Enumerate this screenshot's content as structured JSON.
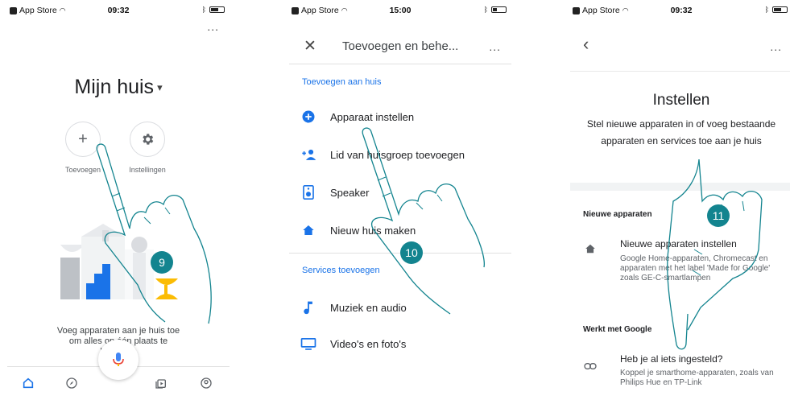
{
  "status": {
    "p1": {
      "carrier": "App Store",
      "time": "09:32"
    },
    "p2": {
      "carrier": "App Store",
      "time": "15:00"
    },
    "p3": {
      "carrier": "App Store",
      "time": "09:32"
    }
  },
  "colors": {
    "accent": "#1a73e8",
    "step_badge": "#13848f",
    "hand_stroke": "#13848f"
  },
  "screen1": {
    "more": "...",
    "title": "Mijn huis",
    "caret": "▾",
    "add_label": "Toevoegen",
    "add_icon": "+",
    "settings_label": "Instellingen",
    "empty_text": "Voeg apparaten aan je huis toe om alles op één plaats te bedienen",
    "nav": [
      "home-icon",
      "explore-icon",
      "media-icon",
      "account-icon"
    ],
    "step": "9"
  },
  "screen2": {
    "more": "...",
    "close": "✕",
    "title": "Toevoegen en behe...",
    "section_add": "Toevoegen aan huis",
    "items_add": [
      {
        "label": "Apparaat instellen",
        "icon": "add-circle-icon"
      },
      {
        "label": "Lid van huisgroep toevoegen",
        "icon": "add-person-icon"
      },
      {
        "label": "Speaker",
        "icon": "speaker-icon"
      },
      {
        "label": "Nieuw huis maken",
        "icon": "home-icon"
      }
    ],
    "section_services": "Services toevoegen",
    "items_services": [
      {
        "label": "Muziek en audio",
        "icon": "music-icon"
      },
      {
        "label": "Video's en foto's",
        "icon": "tv-icon"
      }
    ],
    "step": "10"
  },
  "screen3": {
    "more": "...",
    "back": "‹",
    "title": "Instellen",
    "intro": "Stel nieuwe apparaten in of voeg bestaande apparaten en services toe aan je huis",
    "section_new": "Nieuwe apparaten",
    "new_title": "Nieuwe apparaten instellen",
    "new_desc": "Google Home-apparaten, Chromecast en apparaten met het label 'Made for Google' zoals GE-C-smartlampen",
    "section_works": "Werkt met Google",
    "works_title": "Heb je al iets ingesteld?",
    "works_desc": "Koppel je smarthome-apparaten, zoals van Philips Hue en TP-Link",
    "step": "11"
  }
}
